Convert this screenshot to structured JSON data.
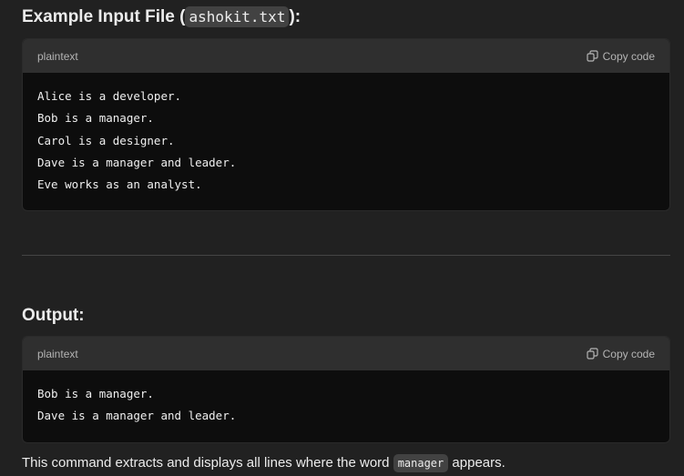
{
  "input_section": {
    "heading_prefix": "Example Input File (",
    "heading_code": "ashokit.txt",
    "heading_suffix": "):",
    "code": {
      "language": "plaintext",
      "copy_label": "Copy code",
      "lines": [
        "Alice is a developer.",
        "Bob is a manager.",
        "Carol is a designer.",
        "Dave is a manager and leader.",
        "Eve works as an analyst."
      ]
    }
  },
  "output_section": {
    "heading": "Output:",
    "code": {
      "language": "plaintext",
      "copy_label": "Copy code",
      "lines": [
        "Bob is a manager.",
        "Dave is a manager and leader."
      ]
    }
  },
  "description": {
    "prefix": "This command extracts and displays all lines where the word ",
    "code": "manager",
    "suffix": " appears."
  },
  "icons": {
    "copy": "copy-icon"
  }
}
